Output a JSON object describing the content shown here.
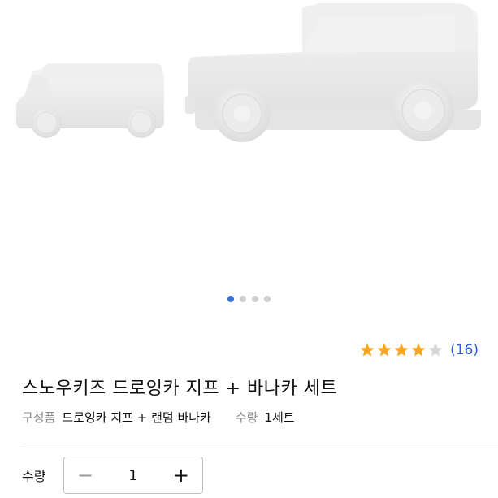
{
  "gallery": {
    "image_alt": "",
    "dot_count": 4,
    "active_index": 0
  },
  "rating": {
    "value": 4,
    "max": 5,
    "count_text": "(16)",
    "star_color": "#f5a623",
    "empty_star_color": "#d6d6d6"
  },
  "product": {
    "title": "스노우키즈 드로잉카 지프 + 바나카 세트",
    "components_label": "구성품",
    "components_value": "드로잉카 지프 + 랜덤 바나카",
    "quantity_label": "수량",
    "quantity_value": "1세트"
  },
  "quantity": {
    "label": "수량",
    "value": "1",
    "minus": "−",
    "plus": "+"
  },
  "colors": {
    "accent": "#3b6fd4",
    "link": "#2a5bd7"
  }
}
